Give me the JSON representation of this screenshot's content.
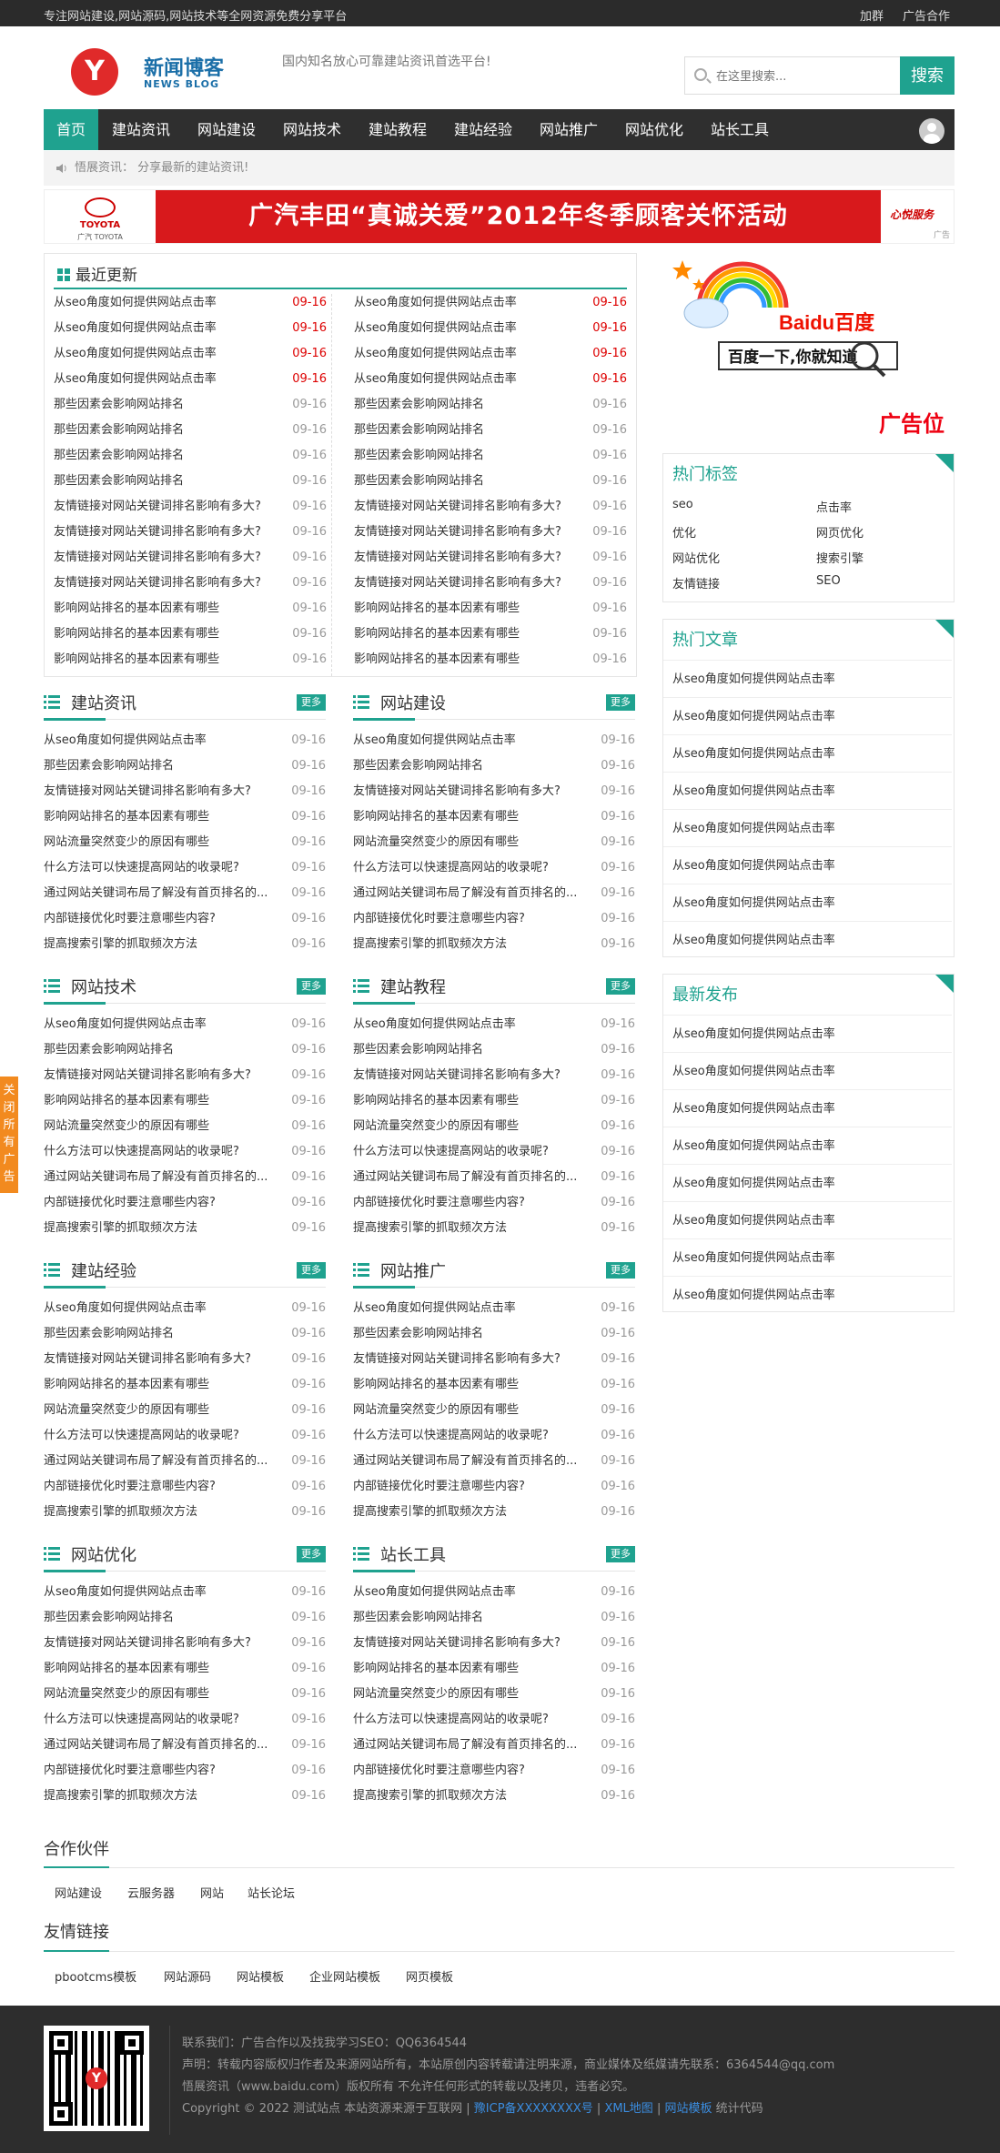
{
  "topbar": {
    "slogan": "专注网站建设,网站源码,网站技术等全网资源免费分享平台",
    "links": [
      "加群",
      "广告合作"
    ]
  },
  "brand": {
    "logo_letter": "Y",
    "name": "新闻博客",
    "name_en": "NEWS BLOG",
    "tagline": "国内知名放心可靠建站资讯首选平台!"
  },
  "search": {
    "placeholder": "在这里搜索...",
    "button": "搜索"
  },
  "nav": [
    "首页",
    "建站资讯",
    "网站建设",
    "网站技术",
    "建站教程",
    "建站经验",
    "网站推广",
    "网站优化",
    "站长工具"
  ],
  "notice": "悟展资讯： 分享最新的建站资讯!",
  "banner": {
    "brand": "TOYOTA",
    "brand_cn": "广汽 TOYOTA",
    "headline": "广汽丰田“真诚关爱”2012年冬季顾客关怀活动",
    "right": "心悦服务",
    "tag": "广告"
  },
  "latest": {
    "title": "最近更新",
    "left": [
      [
        "从seo角度如何提供网站点击率",
        "09-16"
      ],
      [
        "从seo角度如何提供网站点击率",
        "09-16"
      ],
      [
        "从seo角度如何提供网站点击率",
        "09-16"
      ],
      [
        "从seo角度如何提供网站点击率",
        "09-16"
      ],
      [
        "那些因素会影响网站排名",
        "09-16"
      ],
      [
        "那些因素会影响网站排名",
        "09-16"
      ],
      [
        "那些因素会影响网站排名",
        "09-16"
      ],
      [
        "那些因素会影响网站排名",
        "09-16"
      ],
      [
        "友情链接对网站关键词排名影响有多大?",
        "09-16"
      ],
      [
        "友情链接对网站关键词排名影响有多大?",
        "09-16"
      ],
      [
        "友情链接对网站关键词排名影响有多大?",
        "09-16"
      ],
      [
        "友情链接对网站关键词排名影响有多大?",
        "09-16"
      ],
      [
        "影响网站排名的基本因素有哪些",
        "09-16"
      ],
      [
        "影响网站排名的基本因素有哪些",
        "09-16"
      ],
      [
        "影响网站排名的基本因素有哪些",
        "09-16"
      ]
    ],
    "right": [
      [
        "从seo角度如何提供网站点击率",
        "09-16"
      ],
      [
        "从seo角度如何提供网站点击率",
        "09-16"
      ],
      [
        "从seo角度如何提供网站点击率",
        "09-16"
      ],
      [
        "从seo角度如何提供网站点击率",
        "09-16"
      ],
      [
        "那些因素会影响网站排名",
        "09-16"
      ],
      [
        "那些因素会影响网站排名",
        "09-16"
      ],
      [
        "那些因素会影响网站排名",
        "09-16"
      ],
      [
        "那些因素会影响网站排名",
        "09-16"
      ],
      [
        "友情链接对网站关键词排名影响有多大?",
        "09-16"
      ],
      [
        "友情链接对网站关键词排名影响有多大?",
        "09-16"
      ],
      [
        "友情链接对网站关键词排名影响有多大?",
        "09-16"
      ],
      [
        "友情链接对网站关键词排名影响有多大?",
        "09-16"
      ],
      [
        "影响网站排名的基本因素有哪些",
        "09-16"
      ],
      [
        "影响网站排名的基本因素有哪些",
        "09-16"
      ],
      [
        "影响网站排名的基本因素有哪些",
        "09-16"
      ]
    ],
    "red_count": 4
  },
  "categories": [
    {
      "title": "建站资讯",
      "more": "更多"
    },
    {
      "title": "网站建设",
      "more": "更多"
    },
    {
      "title": "网站技术",
      "more": "更多"
    },
    {
      "title": "建站教程",
      "more": "更多"
    },
    {
      "title": "建站经验",
      "more": "更多"
    },
    {
      "title": "网站推广",
      "more": "更多"
    },
    {
      "title": "网站优化",
      "more": "更多"
    },
    {
      "title": "站长工具",
      "more": "更多"
    }
  ],
  "cat_items": [
    [
      "从seo角度如何提供网站点击率",
      "09-16"
    ],
    [
      "那些因素会影响网站排名",
      "09-16"
    ],
    [
      "友情链接对网站关键词排名影响有多大?",
      "09-16"
    ],
    [
      "影响网站排名的基本因素有哪些",
      "09-16"
    ],
    [
      "网站流量突然变少的原因有哪些",
      "09-16"
    ],
    [
      "什么方法可以快速提高网站的收录呢?",
      "09-16"
    ],
    [
      "通过网站关键词布局了解没有首页排名的...",
      "09-16"
    ],
    [
      "内部链接优化时要注意哪些内容?",
      "09-16"
    ],
    [
      "提高搜索引擎的抓取频次方法",
      "09-16"
    ]
  ],
  "sidebar": {
    "ad_label": "广告位",
    "baidu": {
      "logo": "Baidu百度",
      "slogan": "百度一下,你就知道"
    },
    "tags_title": "热门标签",
    "tags": [
      "seo",
      "点击率",
      "优化",
      "网页优化",
      "网站优化",
      "搜索引擎",
      "友情链接",
      "SEO"
    ],
    "hot_title": "热门文章",
    "hot": [
      "从seo角度如何提供网站点击率",
      "从seo角度如何提供网站点击率",
      "从seo角度如何提供网站点击率",
      "从seo角度如何提供网站点击率",
      "从seo角度如何提供网站点击率",
      "从seo角度如何提供网站点击率",
      "从seo角度如何提供网站点击率",
      "从seo角度如何提供网站点击率"
    ],
    "new_title": "最新发布",
    "new": [
      "从seo角度如何提供网站点击率",
      "从seo角度如何提供网站点击率",
      "从seo角度如何提供网站点击率",
      "从seo角度如何提供网站点击率",
      "从seo角度如何提供网站点击率",
      "从seo角度如何提供网站点击率",
      "从seo角度如何提供网站点击率",
      "从seo角度如何提供网站点击率"
    ]
  },
  "partners": {
    "title": "合作伙伴",
    "links": [
      "网站建设",
      "云服务器",
      "网站",
      "站长论坛"
    ]
  },
  "friends": {
    "title": "友情链接",
    "links": [
      "pbootcms模板",
      "网站源码",
      "网站模板",
      "企业网站模板",
      "网页模板"
    ]
  },
  "footer": {
    "contact": "联系我们：广告合作以及找我学习SEO：QQ6364544",
    "statement": "声明：转载内容版权归作者及来源网站所有，本站原创内容转载请注明来源，商业媒体及纸媒请先联系：6364544@qq.com",
    "copyright_line": "悟展资讯（www.baidu.com）版权所有 不允许任何形式的转载以及拷贝，违者必究。",
    "copy_prefix": "Copyright © 2022 测试站点 本站资源来源于互联网 | ",
    "icp": "豫ICP备XXXXXXXX号",
    "sep1": " | ",
    "xml": "XML地图",
    "sep2": " | ",
    "tpl": "网站模板",
    "stat": " 统计代码"
  },
  "side_ad": "关闭所有广告"
}
